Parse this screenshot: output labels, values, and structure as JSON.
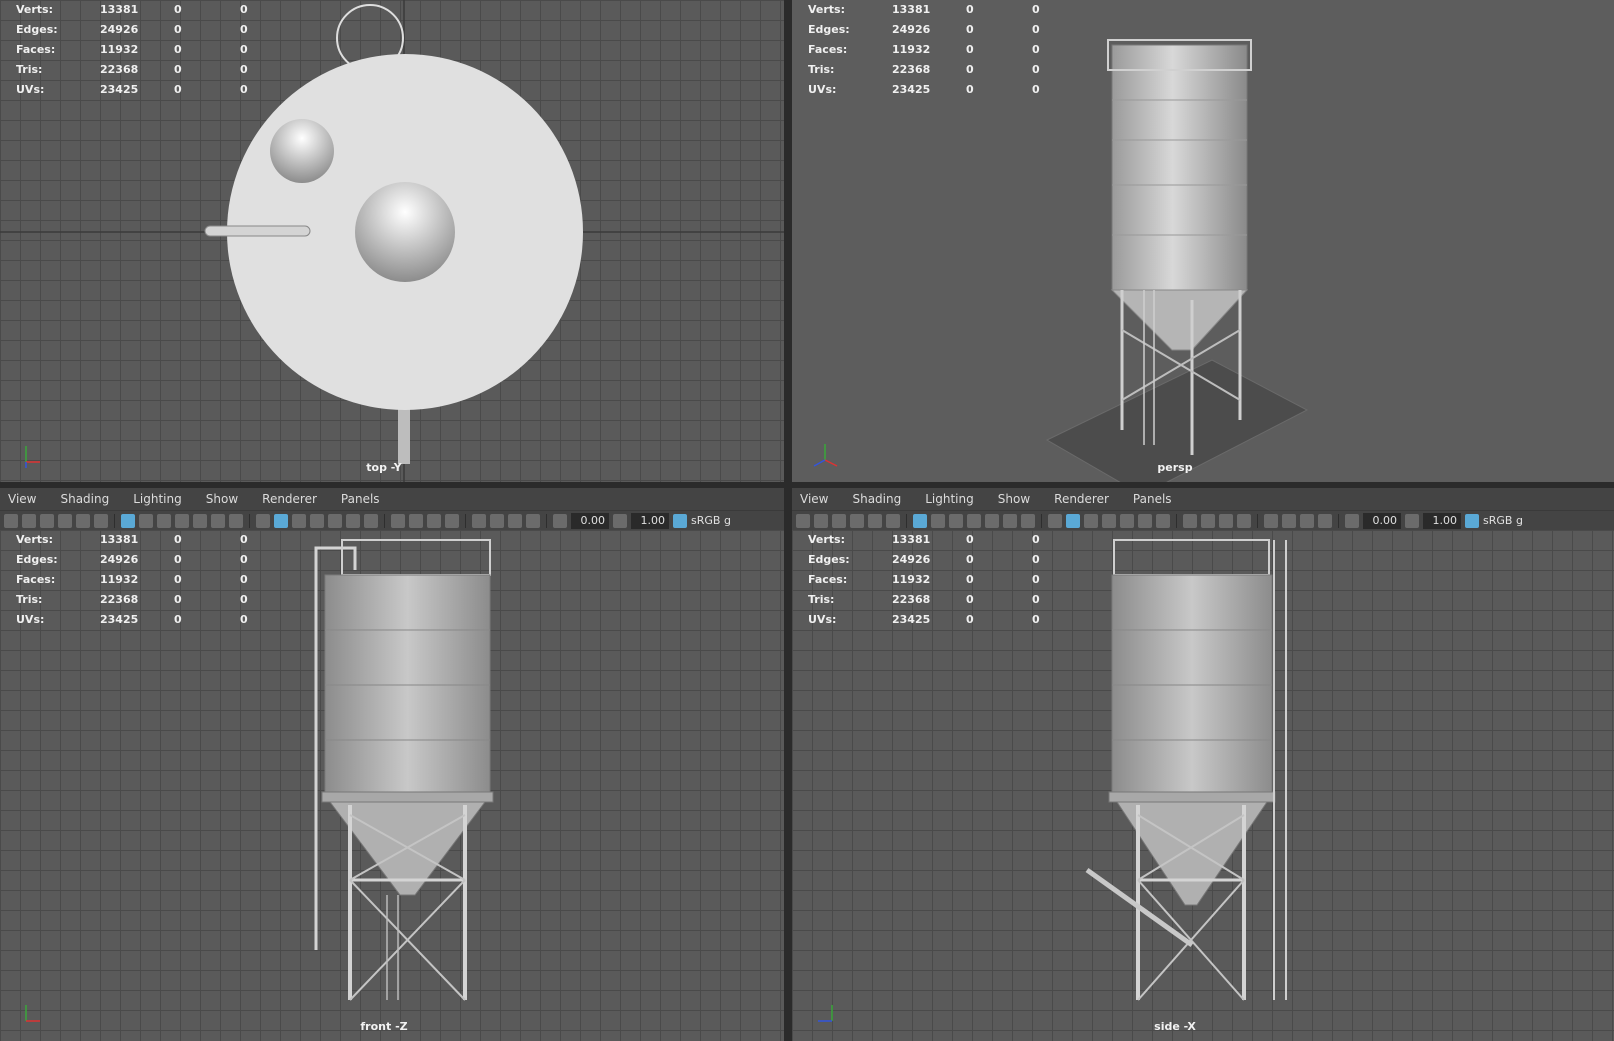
{
  "stats": [
    {
      "label": "Verts:",
      "v1": "13381",
      "v2": "0",
      "v3": "0"
    },
    {
      "label": "Edges:",
      "v1": "24926",
      "v2": "0",
      "v3": "0"
    },
    {
      "label": "Faces:",
      "v1": "11932",
      "v2": "0",
      "v3": "0"
    },
    {
      "label": "Tris:",
      "v1": "22368",
      "v2": "0",
      "v3": "0"
    },
    {
      "label": "UVs:",
      "v1": "23425",
      "v2": "0",
      "v3": "0"
    }
  ],
  "viewports": {
    "top": {
      "camera": "top -Y"
    },
    "persp": {
      "camera": "persp"
    },
    "front": {
      "camera": "front -Z"
    },
    "side": {
      "camera": "side -X"
    }
  },
  "menu": [
    "View",
    "Shading",
    "Lighting",
    "Show",
    "Renderer",
    "Panels"
  ],
  "toolbar": {
    "exposure": "0.00",
    "gamma": "1.00",
    "color_space": "sRGB g"
  }
}
